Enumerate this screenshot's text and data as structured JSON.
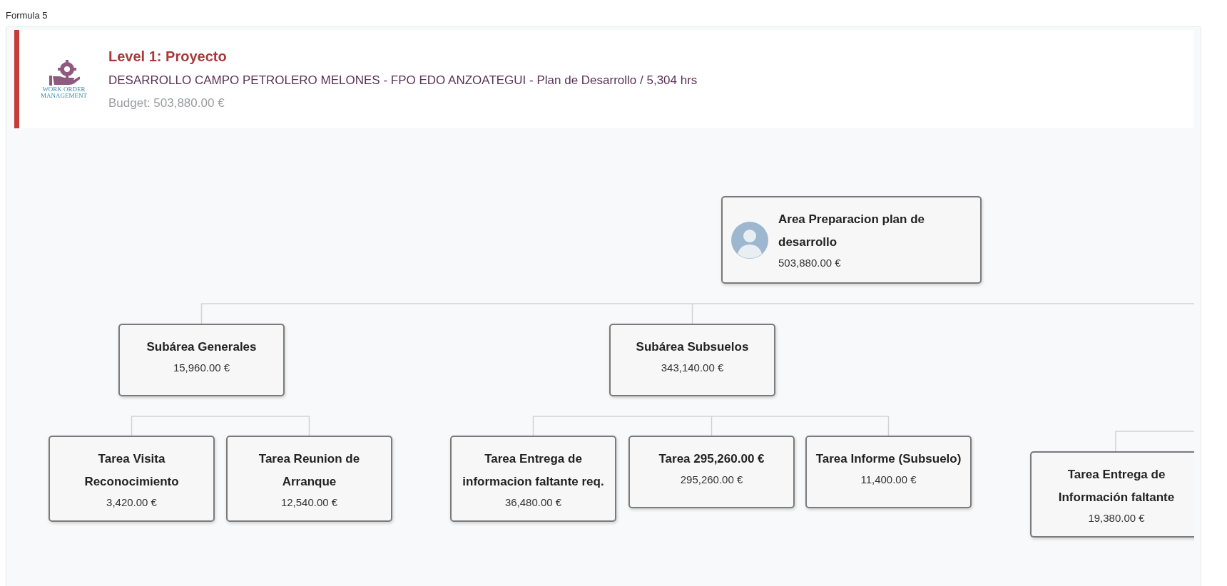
{
  "page_title": "Formula 5",
  "header": {
    "level": "Level 1: Proyecto",
    "description": "DESARROLLO CAMPO PETROLERO MELONES - FPO EDO ANZOATEGUI - Plan de Desarrollo / 5,304 hrs",
    "budget": "Budget: 503,880.00 €",
    "logo_text": "WORK ORDER MANAGEMENT"
  },
  "org_chart": {
    "root": {
      "name": "Area Preparacion plan de desarrollo",
      "amount": "503,880.00 €",
      "children": [
        {
          "name": "Subárea Generales",
          "amount": "15,960.00 €",
          "children": [
            {
              "name": "Tarea Visita Reconocimiento",
              "amount": "3,420.00 €"
            },
            {
              "name": "Tarea Reunion de Arranque",
              "amount": "12,540.00 €"
            }
          ]
        },
        {
          "name": "Subárea Subsuelos",
          "amount": "343,140.00 €",
          "children": [
            {
              "name": "Tarea Entrega de informacion faltante req.",
              "amount": "36,480.00 €"
            },
            {
              "name": "Tarea 295,260.00 €",
              "amount": "295,260.00 €"
            },
            {
              "name": "Tarea Informe (Subsuelo)",
              "amount": "11,400.00 €"
            }
          ]
        }
      ]
    },
    "cut_off_branch_tasks": [
      {
        "name": "Tarea Entrega de Información faltante",
        "amount": "19,380.00 €"
      }
    ]
  }
}
